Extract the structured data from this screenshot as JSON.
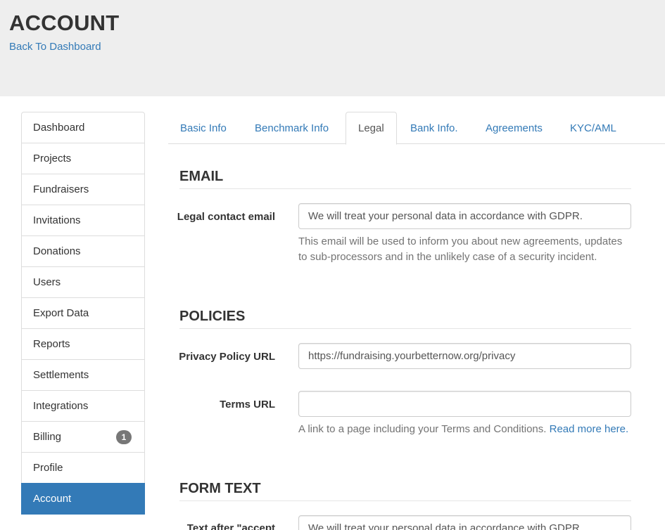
{
  "header": {
    "title": "ACCOUNT",
    "back_link": "Back To Dashboard"
  },
  "sidebar": {
    "items": [
      {
        "label": "Dashboard"
      },
      {
        "label": "Projects"
      },
      {
        "label": "Fundraisers"
      },
      {
        "label": "Invitations"
      },
      {
        "label": "Donations"
      },
      {
        "label": "Users"
      },
      {
        "label": "Export Data"
      },
      {
        "label": "Reports"
      },
      {
        "label": "Settlements"
      },
      {
        "label": "Integrations"
      },
      {
        "label": "Billing",
        "badge": "1"
      },
      {
        "label": "Profile"
      },
      {
        "label": "Account",
        "active": true
      }
    ]
  },
  "tabs": [
    {
      "label": "Basic Info"
    },
    {
      "label": "Benchmark Info"
    },
    {
      "label": "Legal",
      "active": true
    },
    {
      "label": "Bank Info."
    },
    {
      "label": "Agreements"
    },
    {
      "label": "KYC/AML"
    }
  ],
  "sections": {
    "email": {
      "title": "EMAIL",
      "legal_contact_label": "Legal contact email",
      "legal_contact_value": "We will treat your personal data in accordance with GDPR.",
      "help": "This email will be used to inform you about new agreements, updates to sub-processors and in the unlikely case of a security incident."
    },
    "policies": {
      "title": "POLICIES",
      "privacy_label": "Privacy Policy URL",
      "privacy_value": "https://fundraising.yourbetternow.org/privacy",
      "terms_label": "Terms URL",
      "terms_value": "",
      "terms_help": "A link to a page including your Terms and Conditions.",
      "terms_help_link": "Read more here."
    },
    "form_text": {
      "title": "FORM TEXT",
      "accept_label": "Text after \"accept",
      "accept_value": "We will treat your personal data in accordance with GDPR."
    }
  },
  "colors": {
    "accent": "#337ab7",
    "header_bg": "#eeeeee",
    "badge": "#777777"
  }
}
